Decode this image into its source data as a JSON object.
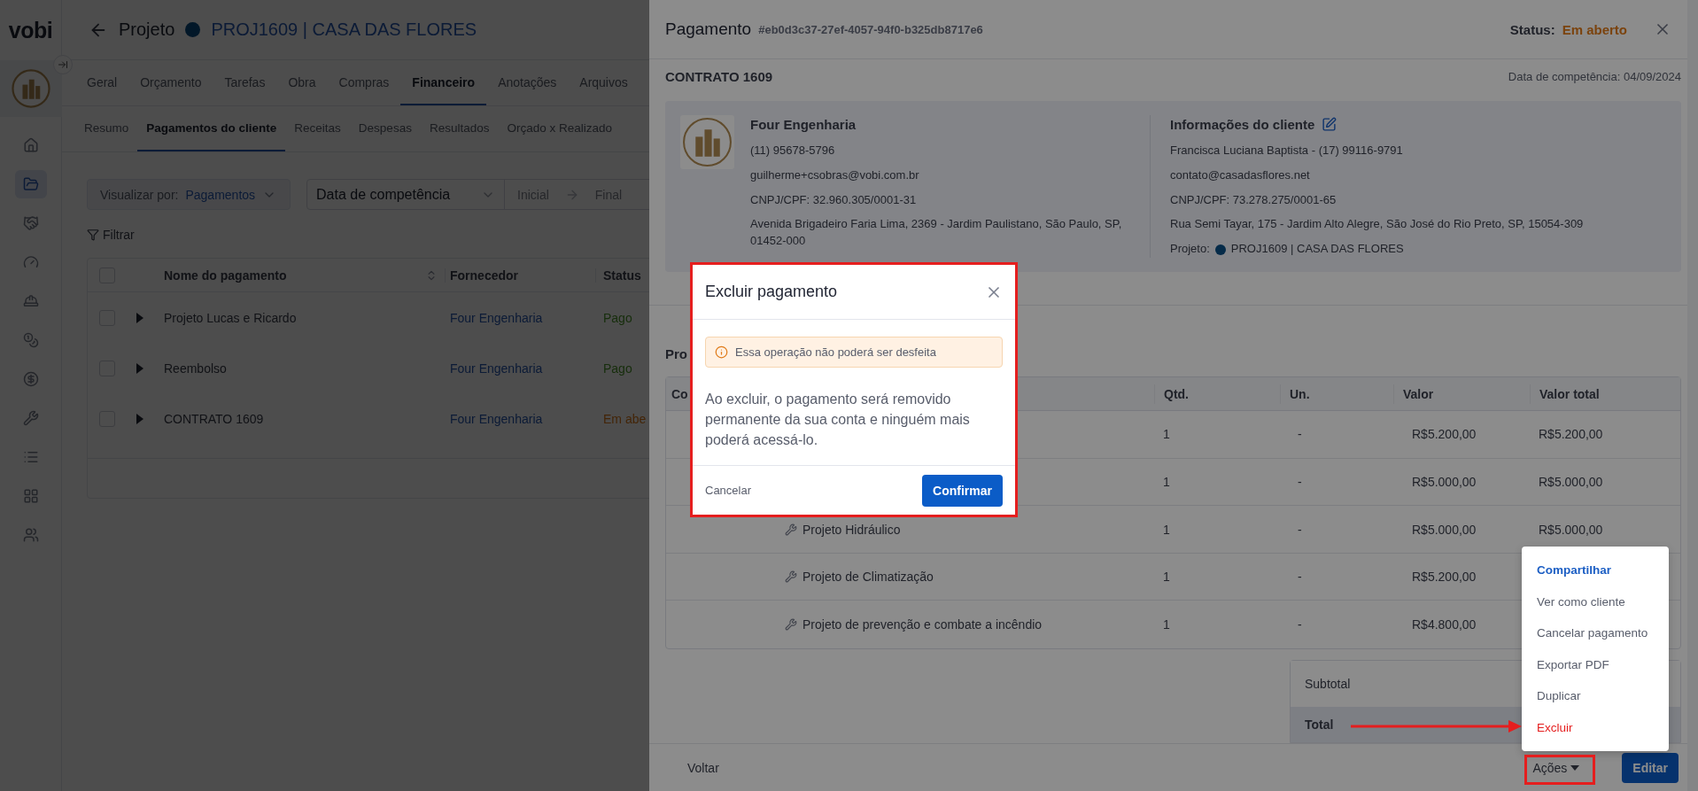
{
  "sidebar": {
    "logo": "vobi",
    "items": [
      {
        "selected": false
      },
      {
        "selected": true
      },
      {
        "selected": false
      },
      {
        "selected": false
      },
      {
        "selected": false
      },
      {
        "selected": false
      },
      {
        "selected": false
      },
      {
        "selected": false
      },
      {
        "selected": false
      },
      {
        "selected": false
      },
      {
        "selected": false
      }
    ]
  },
  "project": {
    "label": "Projeto",
    "name": "PROJ1609 | CASA DAS FLORES"
  },
  "tabs": [
    {
      "label": "Geral",
      "selected": false
    },
    {
      "label": "Orçamento",
      "selected": false
    },
    {
      "label": "Tarefas",
      "selected": false
    },
    {
      "label": "Obra",
      "selected": false
    },
    {
      "label": "Compras",
      "selected": false
    },
    {
      "label": "Financeiro",
      "selected": true
    },
    {
      "label": "Anotações",
      "selected": false
    },
    {
      "label": "Arquivos",
      "selected": false
    }
  ],
  "subtabs": [
    {
      "label": "Resumo",
      "selected": false
    },
    {
      "label": "Pagamentos do cliente",
      "selected": true
    },
    {
      "label": "Receitas",
      "selected": false
    },
    {
      "label": "Despesas",
      "selected": false
    },
    {
      "label": "Resultados",
      "selected": false
    },
    {
      "label": "Orçado x Realizado",
      "selected": false
    }
  ],
  "filters": {
    "view_label": "Visualizar por:",
    "view_value": "Pagamentos",
    "date_field": "Data de competência",
    "start_placeholder": "Inicial",
    "end_placeholder": "Final",
    "filter_button": "Filtrar"
  },
  "payments_table": {
    "all_checked": false,
    "columns": [
      "Nome do pagamento",
      "Fornecedor",
      "Status"
    ],
    "rows": [
      {
        "checked": false,
        "name": "Projeto Lucas e Ricardo",
        "supplier": "Four Engenharia",
        "status": "Pago",
        "paid": true
      },
      {
        "checked": false,
        "name": "Reembolso",
        "supplier": "Four Engenharia",
        "status": "Pago",
        "paid": true
      },
      {
        "checked": false,
        "name": "CONTRATO 1609",
        "supplier": "Four Engenharia",
        "status": "Em abe",
        "paid": false
      }
    ]
  },
  "drawer": {
    "title": "Pagamento",
    "id": "#eb0d3c37-27ef-4057-94f0-b325db8717e6",
    "status_label": "Status:",
    "status": "Em aberto",
    "name": "CONTRATO 1609",
    "date": "Data de competência: 04/09/2024",
    "supplier": {
      "name": "Four Engenharia",
      "lines": [
        "(11) 95678-5796",
        "guilherme+csobras@vobi.com.br",
        "CNPJ/CPF: 32.960.305/0001-31",
        "Avenida Brigadeiro Faria Lima, 2369 - Jardim Paulistano, São Paulo, SP, 01452-000"
      ]
    },
    "client": {
      "title": "Informações do cliente",
      "lines": [
        "Francisca Luciana Baptista - (17) 99116-9791",
        "contato@casadasflores.net",
        "CNPJ/CPF: 73.278.275/0001-65",
        "Rua Semi Tayar, 175 - Jardim Alto Alegre, São José do Rio Preto, SP, 15054-309"
      ],
      "project_label": "Projeto:",
      "project": "PROJ1609 | CASA DAS FLORES"
    },
    "section_title": "Pro",
    "items_table": {
      "columns": [
        "Co",
        "Qtd.",
        "Un.",
        "Valor",
        "Valor total"
      ],
      "rows": [
        {
          "qty": "1",
          "unit": "-",
          "value": "R$5.200,00",
          "total": "R$5.200,00"
        },
        {
          "qty": "1",
          "unit": "-",
          "value": "R$5.000,00",
          "total": "R$5.000,00"
        },
        {
          "name": "Projeto Hidráulico",
          "qty": "1",
          "unit": "-",
          "value": "R$5.000,00",
          "total": "R$5.000,00"
        },
        {
          "name": "Projeto de Climatização",
          "qty": "1",
          "unit": "-",
          "value": "R$5.200,00"
        },
        {
          "name": "Projeto de prevenção e combate a incêndio",
          "qty": "1",
          "unit": "-",
          "value": "R$4.800,00"
        }
      ]
    },
    "totals": {
      "subtotal_label": "Subtotal",
      "total_label": "Total"
    },
    "footer": {
      "back": "Voltar",
      "actions": "Ações",
      "edit": "Editar"
    }
  },
  "modal": {
    "title": "Excluir pagamento",
    "warning": "Essa operação não poderá ser desfeita",
    "message": "Ao excluir, o pagamento será removido permanente da sua conta e ninguém mais poderá acessá-lo.",
    "cancel": "Cancelar",
    "confirm": "Confirmar"
  },
  "actions_menu": [
    {
      "label": "Compartilhar",
      "selected": true,
      "color": "#1d5fc4"
    },
    {
      "label": "Ver como cliente",
      "selected": false,
      "color": "#585d6b"
    },
    {
      "label": "Cancelar pagamento",
      "selected": false,
      "color": "#585d6b"
    },
    {
      "label": "Exportar PDF",
      "selected": false,
      "color": "#585d6b"
    },
    {
      "label": "Duplicar",
      "selected": false,
      "color": "#585d6b"
    },
    {
      "label": "Excluir",
      "selected": false,
      "color": "#e51e1e"
    }
  ]
}
